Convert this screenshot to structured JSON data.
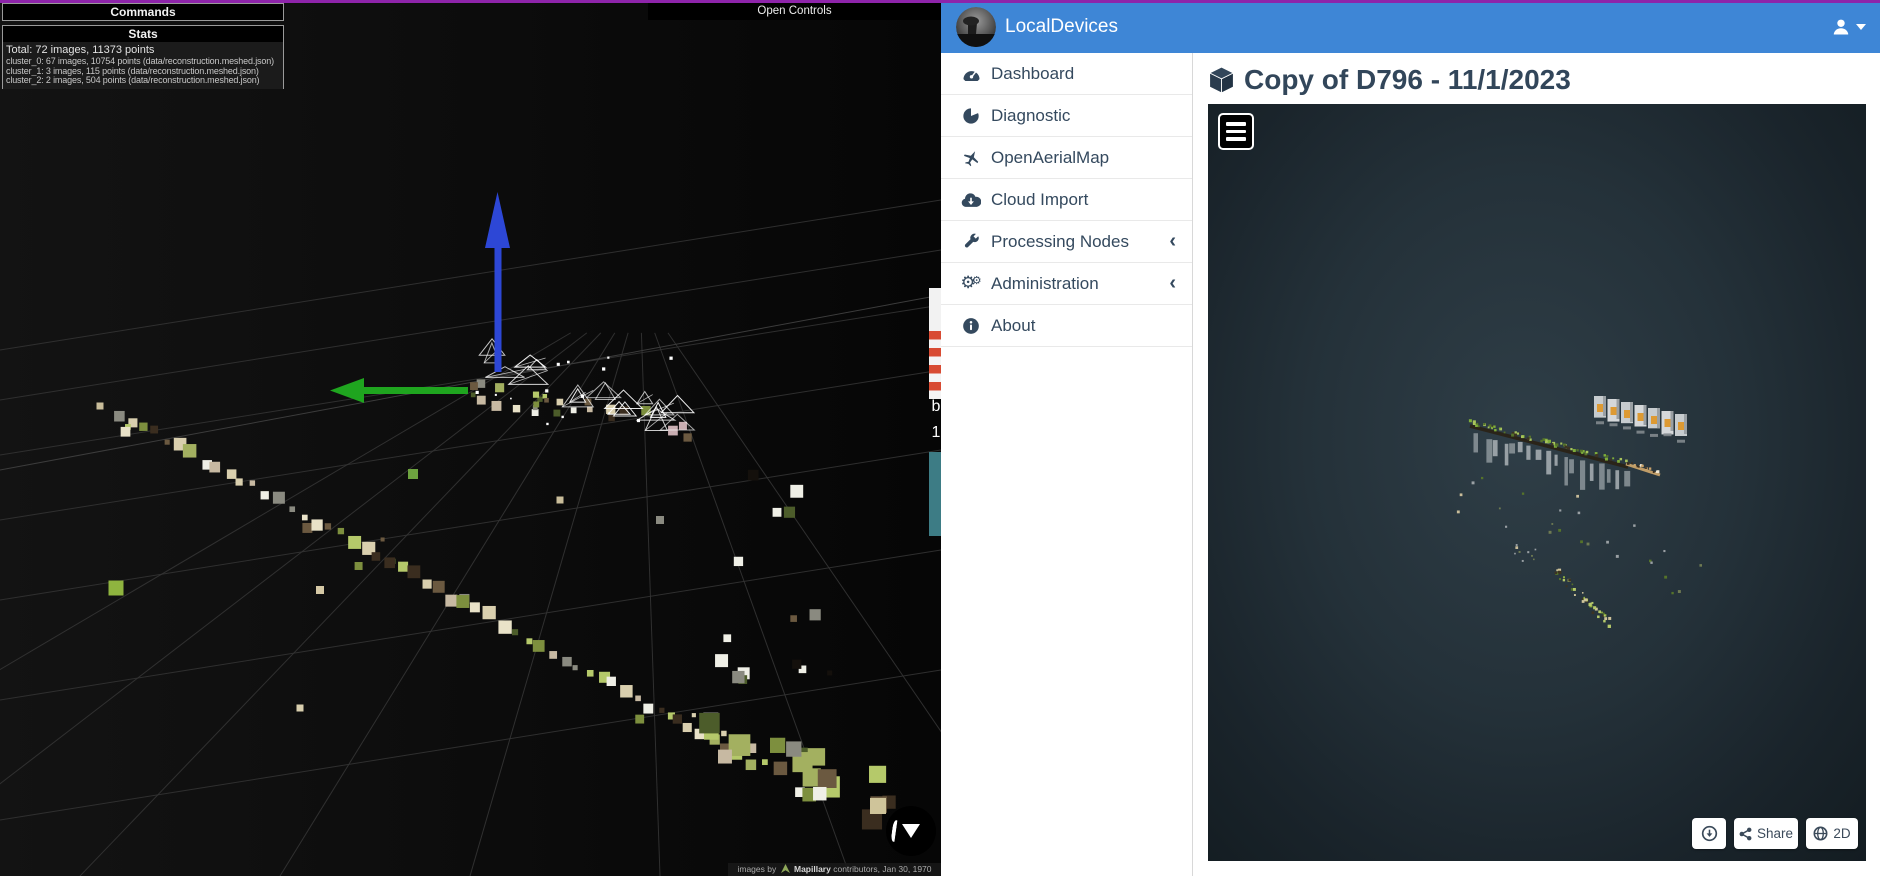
{
  "accent_color": "#8e24aa",
  "left_viewer": {
    "commands_title": "Commands",
    "stats_title": "Stats",
    "stats_total": "Total: 72 images, 11373 points",
    "stats_clusters": [
      "cluster_0: 67 images, 10754 points (data/reconstruction.meshed.json)",
      "cluster_1: 3 images, 115 points (data/reconstruction.meshed.json)",
      "cluster_2: 2 images, 504 points (data/reconstruction.meshed.json)"
    ],
    "open_controls_label": "Open Controls",
    "ruler_labels": [
      "b",
      "1"
    ],
    "attribution_prefix": "images by",
    "attribution_brand": "Mapillary",
    "attribution_suffix": "contributors, Jan 30, 1970",
    "axis_colors": {
      "up_axis": "#2d47d6",
      "left_axis": "#1fa51f"
    }
  },
  "app": {
    "title": "LocalDevices",
    "header_color": "#3e86d6",
    "sidebar": {
      "items": [
        {
          "label": "Dashboard"
        },
        {
          "label": "Diagnostic"
        },
        {
          "label": "OpenAerialMap"
        },
        {
          "label": "Cloud Import"
        },
        {
          "label": "Processing Nodes",
          "collapsible": true
        },
        {
          "label": "Administration",
          "collapsible": true
        },
        {
          "label": "About"
        }
      ]
    },
    "page_title": "Copy of D796 - 11/1/2023",
    "viewer": {
      "share_label": "Share",
      "mode_2d_label": "2D"
    }
  }
}
